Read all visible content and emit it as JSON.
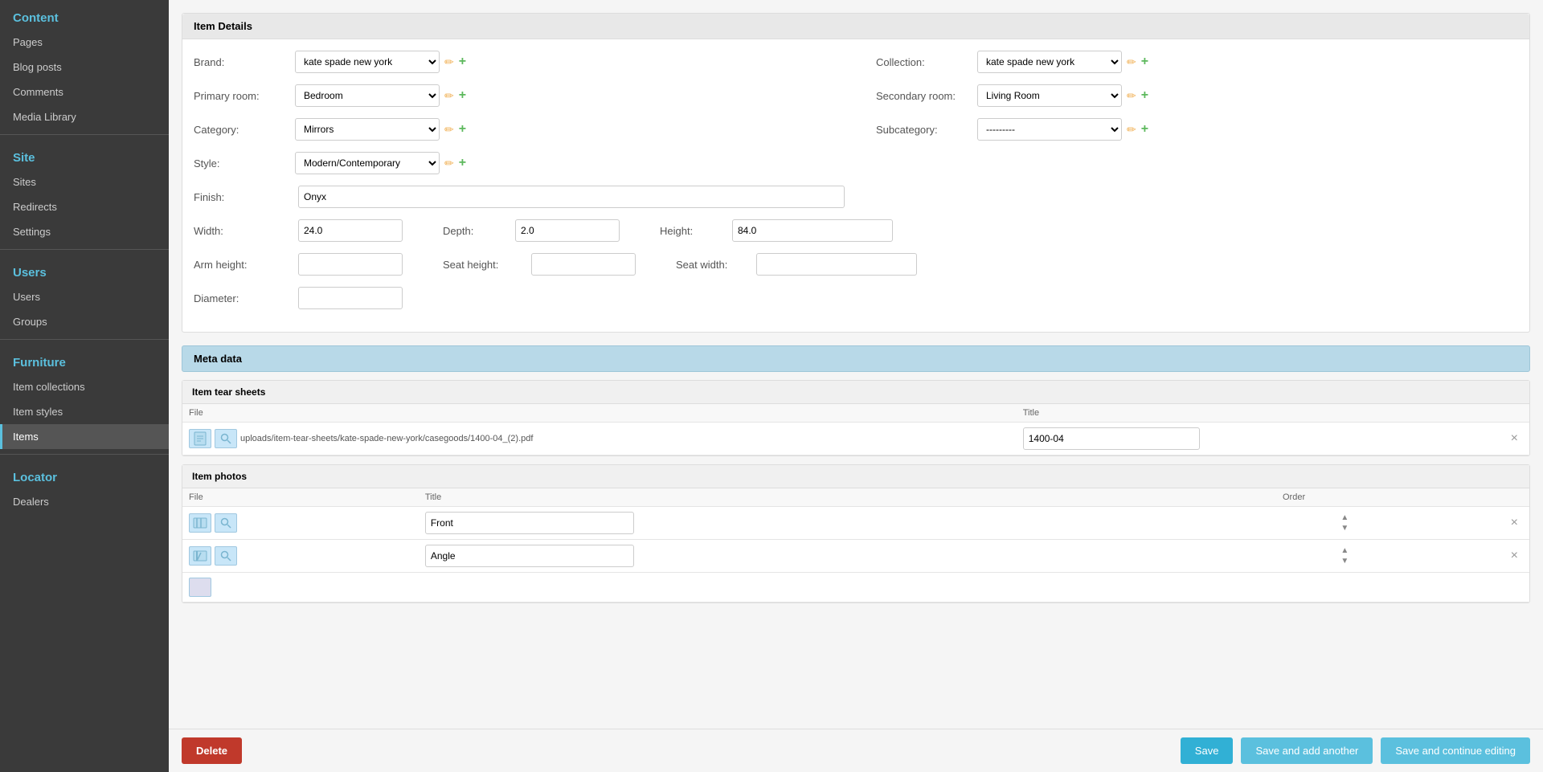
{
  "sidebar": {
    "content_title": "Content",
    "items_content": [
      "Pages",
      "Blog posts",
      "Comments",
      "Media Library"
    ],
    "site_title": "Site",
    "items_site": [
      "Sites",
      "Redirects",
      "Settings"
    ],
    "users_title": "Users",
    "items_users": [
      "Users",
      "Groups"
    ],
    "furniture_title": "Furniture",
    "items_furniture": [
      "Item collections",
      "Item styles",
      "Items"
    ],
    "locator_title": "Locator",
    "items_locator": [
      "Dealers"
    ]
  },
  "form": {
    "item_details_header": "Item Details",
    "brand_label": "Brand:",
    "brand_value": "kate spade new york",
    "collection_label": "Collection:",
    "collection_value": "kate spade new york",
    "primary_room_label": "Primary room:",
    "primary_room_value": "Bedroom",
    "secondary_room_label": "Secondary room:",
    "secondary_room_value": "Living Room",
    "category_label": "Category:",
    "category_value": "Mirrors",
    "subcategory_label": "Subcategory:",
    "subcategory_value": "---------",
    "style_label": "Style:",
    "style_value": "Modern/Contemporary",
    "finish_label": "Finish:",
    "finish_value": "Onyx",
    "width_label": "Width:",
    "width_value": "24.0",
    "depth_label": "Depth:",
    "depth_value": "2.0",
    "height_label": "Height:",
    "height_value": "84.0",
    "arm_height_label": "Arm height:",
    "arm_height_value": "",
    "seat_height_label": "Seat height:",
    "seat_height_value": "",
    "seat_width_label": "Seat width:",
    "seat_width_value": "",
    "diameter_label": "Diameter:",
    "diameter_value": ""
  },
  "meta": {
    "header": "Meta data"
  },
  "tear_sheets": {
    "header": "Item tear sheets",
    "col_file": "File",
    "col_title": "Title",
    "row1_path": "uploads/item-tear-sheets/kate-spade-new-york/casegoods/1400-04_(2).pdf",
    "row1_title": "1400-04"
  },
  "photos": {
    "header": "Item photos",
    "col_file": "File",
    "col_title": "Title",
    "col_order": "Order",
    "row1_title": "Front",
    "row2_title": "Angle"
  },
  "buttons": {
    "delete": "Delete",
    "save": "Save",
    "save_add": "Save and add another",
    "save_continue": "Save and continue editing"
  }
}
